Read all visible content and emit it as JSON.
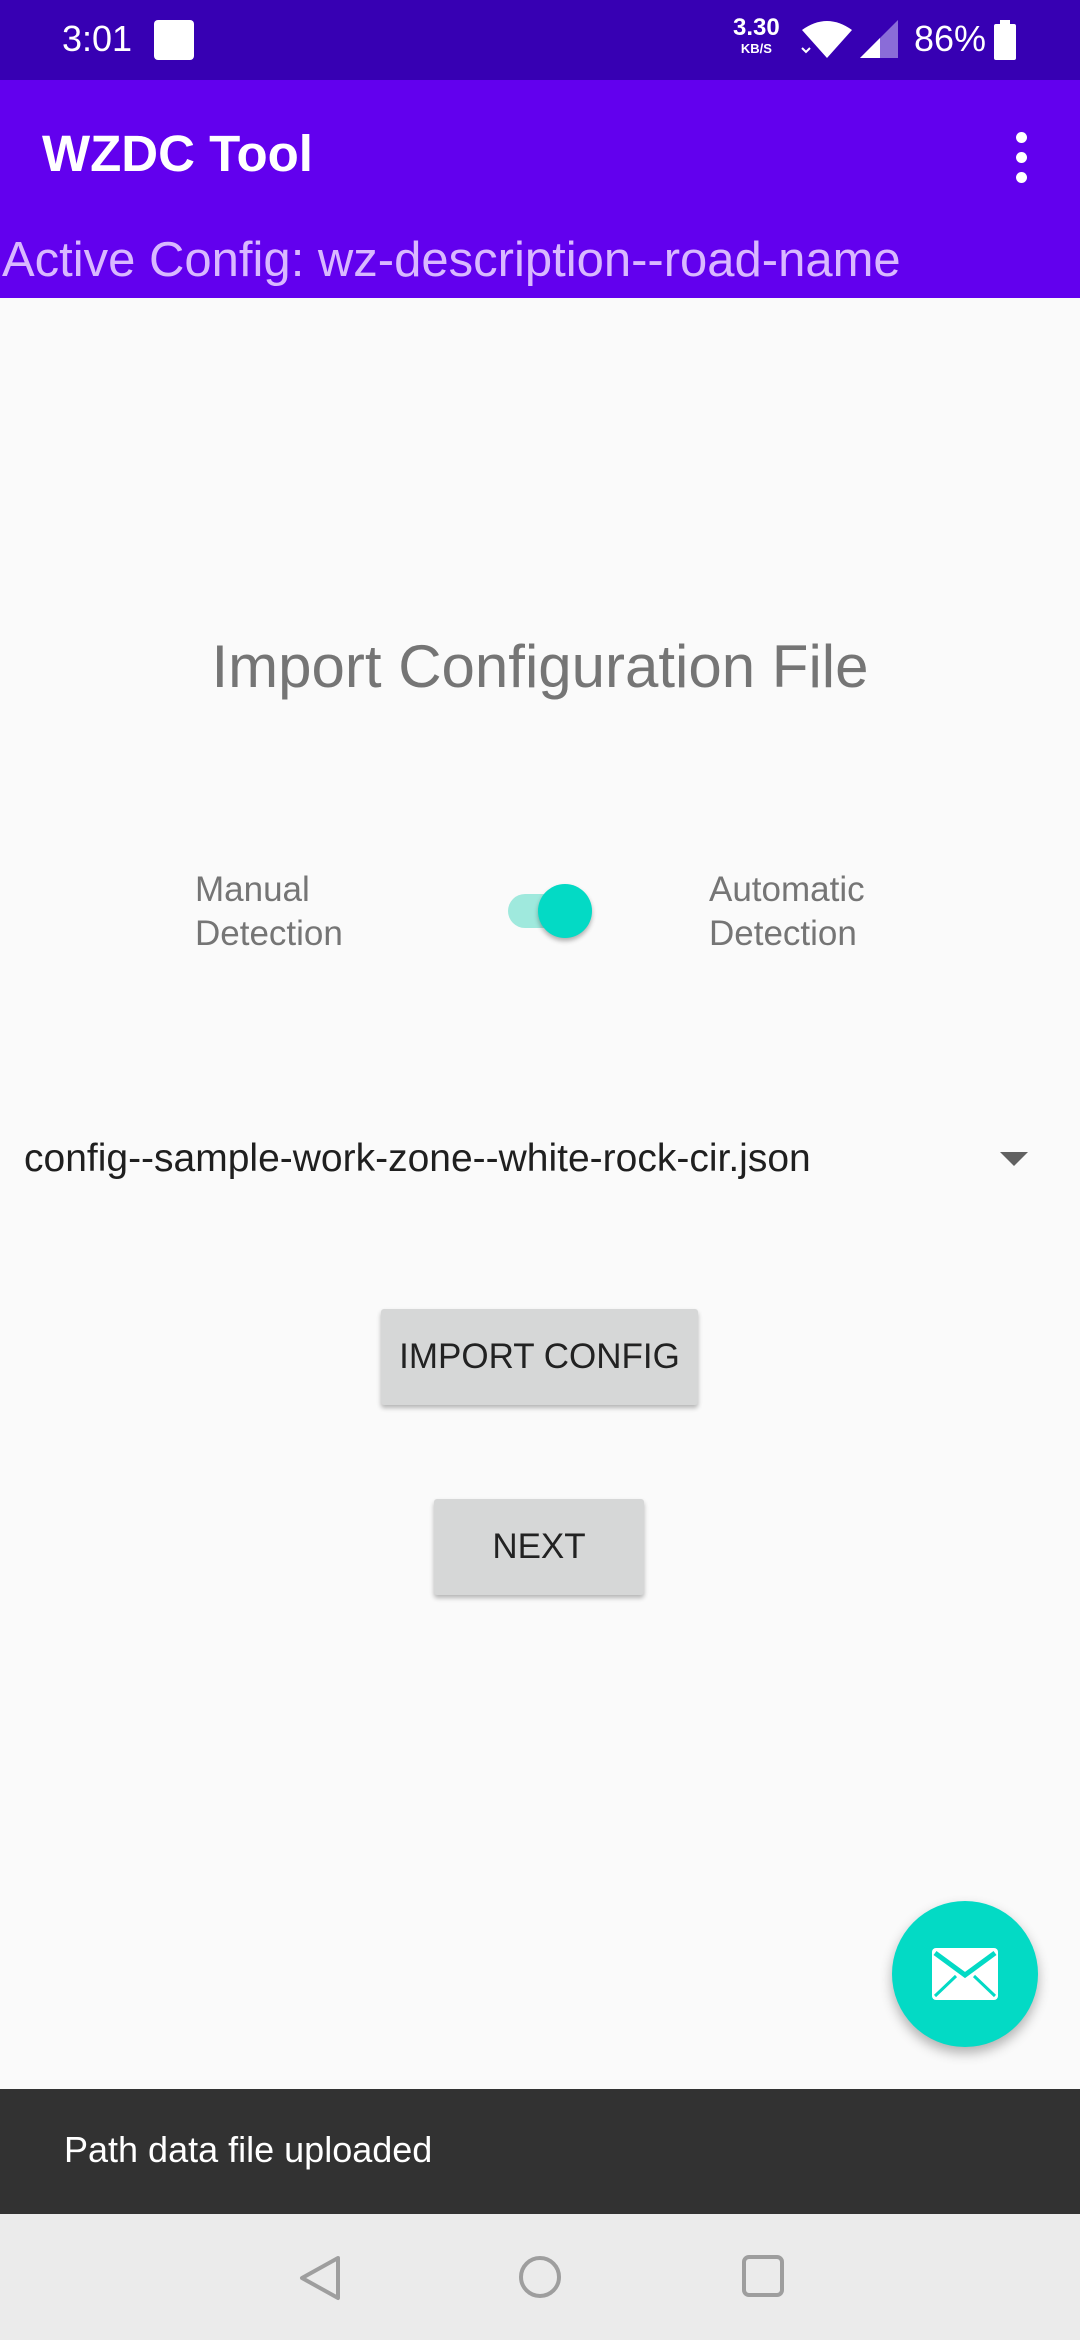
{
  "status_bar": {
    "time": "3:01",
    "net_speed_value": "3.30",
    "net_speed_unit": "KB/S",
    "battery_percent": "86%",
    "icons": [
      "notification-square-icon",
      "wifi-icon",
      "cell-signal-icon",
      "battery-icon"
    ]
  },
  "app_bar": {
    "title": "WZDC Tool",
    "active_config": "Active Config: wz-description--road-name",
    "overflow_icon": "more-vert-icon"
  },
  "main": {
    "title": "Import Configuration File",
    "toggle": {
      "left_label_line1": "Manual",
      "left_label_line2": "Detection",
      "right_label_line1": "Automatic",
      "right_label_line2": "Detection",
      "checked": true
    },
    "spinner": {
      "selected": "config--sample-work-zone--white-rock-cir.json"
    },
    "import_button": "IMPORT CONFIG",
    "next_button": "NEXT"
  },
  "fab": {
    "icon": "email-icon"
  },
  "snackbar": {
    "message": "Path data file uploaded"
  },
  "nav_bar": {
    "icons": [
      "back-icon",
      "home-icon",
      "recents-icon"
    ]
  },
  "colors": {
    "status_bar": "#3700b3",
    "primary": "#6200ee",
    "accent": "#03dac5",
    "snackbar": "#323232"
  }
}
